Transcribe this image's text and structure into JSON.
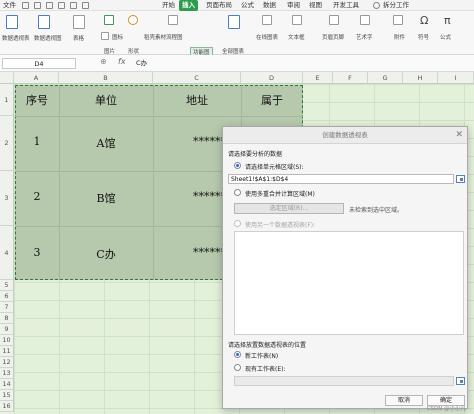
{
  "menu": {
    "file": "文件",
    "tabs": [
      "开始",
      "插入",
      "页面布局",
      "公式",
      "数据",
      "审阅",
      "视图",
      "开发工具"
    ],
    "active_tab_index": 1,
    "right_item": "拆分工作",
    "accent": "#2e9c4f"
  },
  "ribbon": {
    "buttons": [
      "数据透视表",
      "数据透视图",
      "表格",
      "图片",
      "形状",
      "图标",
      "稻壳素材",
      "流程图",
      "功能图",
      "全部图表",
      "在线图表",
      "文本框",
      "页眉页脚",
      "艺术字",
      "附件",
      "符号",
      "公式"
    ],
    "active_button": "功能图"
  },
  "formula_bar": {
    "name_box": "D4",
    "fx_label": "fx",
    "content": "C办"
  },
  "columns": [
    "A",
    "B",
    "C",
    "D",
    "E",
    "F",
    "G",
    "H",
    "I"
  ],
  "rows": [
    "1",
    "2",
    "3",
    "4",
    "5",
    "6",
    "7",
    "8",
    "9",
    "10",
    "11",
    "12",
    "13",
    "14",
    "15",
    "16",
    "17"
  ],
  "table": {
    "headers": [
      "序号",
      "单位",
      "地址",
      "属于"
    ],
    "rows": [
      [
        "1",
        "A馆",
        "*******"
      ],
      [
        "2",
        "B馆",
        "*******"
      ],
      [
        "3",
        "C办",
        "*******"
      ]
    ]
  },
  "dialog": {
    "title": "创建数据透视表",
    "close_icon": "close-icon",
    "section1": "请选择要分析的数据",
    "opt_range": "请选择单元格区域(S):",
    "range_value": "Sheet1!$A$1:$D$4",
    "opt_multi": "使用多重合并计算区域(M)",
    "select_area_btn": "选定区域(R)...",
    "no_select_hint": "未检索到选中区域。",
    "opt_other": "使用另一个数据透视表(F):",
    "section2": "请选择放置数据透视表的位置",
    "opt_new_sheet": "新工作表(N)",
    "opt_existing": "现有工作表(E):",
    "cancel": "取消",
    "ok": "确定"
  },
  "watermark": "CSDN @小小凡"
}
